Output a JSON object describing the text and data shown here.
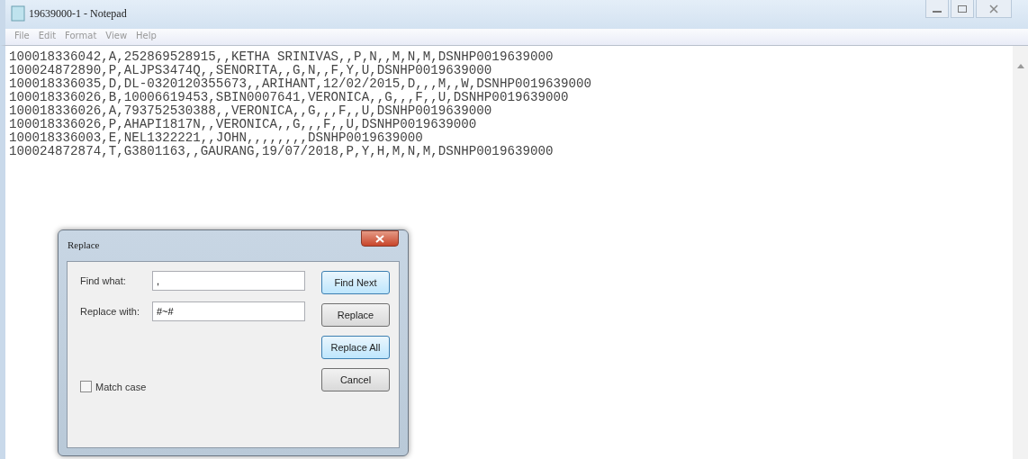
{
  "window": {
    "title": "19639000-1 - Notepad"
  },
  "menu": [
    "File",
    "Edit",
    "Format",
    "View",
    "Help"
  ],
  "lines": [
    "100018336042,A,252869528915,,KETHA SRINIVAS,,P,N,,M,N,M,DSNHP0019639000",
    "100024872890,P,ALJPS3474Q,,SENORITA,,G,N,,F,Y,U,DSNHP0019639000",
    "100018336035,D,DL-0320120355673,,ARIHANT,12/02/2015,D,,,M,,W,DSNHP0019639000",
    "100018336026,B,10006619453,SBIN0007641,VERONICA,,G,,,F,,U,DSNHP0019639000",
    "100018336026,A,793752530388,,VERONICA,,G,,,F,,U,DSNHP0019639000",
    "100018336026,P,AHAPI1817N,,VERONICA,,G,,,F,,U,DSNHP0019639000",
    "100018336003,E,NEL1322221,,JOHN,,,,,,,,DSNHP0019639000",
    "100024872874,T,G3801163,,GAURANG,19/07/2018,P,Y,H,M,N,M,DSNHP0019639000"
  ],
  "dialog": {
    "title": "Replace",
    "fields": [
      {
        "label": "Find what:",
        "value": ","
      },
      {
        "label": "Replace with:",
        "value": "#~#"
      }
    ],
    "buttons": [
      {
        "label": "Find Next",
        "selected": true
      },
      {
        "label": "Replace",
        "selected": false
      },
      {
        "label": "Replace All",
        "selected": true
      },
      {
        "label": "Cancel",
        "selected": false
      }
    ],
    "match_case": {
      "label": "Match case",
      "checked": false
    }
  }
}
